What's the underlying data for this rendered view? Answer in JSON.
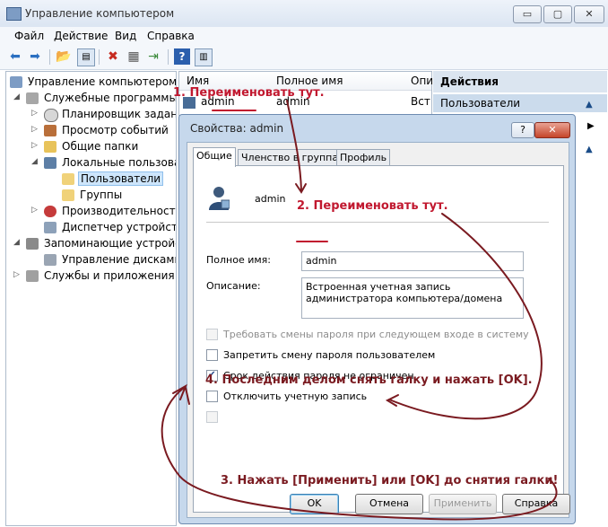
{
  "window": {
    "title": "Управление компьютером",
    "min": "▭",
    "max": "▢",
    "close": "✕"
  },
  "menu": [
    "Файл",
    "Действие",
    "Вид",
    "Справка"
  ],
  "tree": [
    {
      "label": "Управление компьютером (л",
      "depth": 0
    },
    {
      "label": "Служебные программы",
      "depth": 1
    },
    {
      "label": "Планировщик заданий",
      "depth": 2
    },
    {
      "label": "Просмотр событий",
      "depth": 2
    },
    {
      "label": "Общие папки",
      "depth": 2
    },
    {
      "label": "Локальные пользовате",
      "depth": 2
    },
    {
      "label": "Пользователи",
      "depth": 3
    },
    {
      "label": "Группы",
      "depth": 3
    },
    {
      "label": "Производительность",
      "depth": 2
    },
    {
      "label": "Диспетчер устройств",
      "depth": 2
    },
    {
      "label": "Запоминающие устройст",
      "depth": 1
    },
    {
      "label": "Управление дисками",
      "depth": 2
    },
    {
      "label": "Службы и приложения",
      "depth": 1
    }
  ],
  "list": {
    "col_name": "Имя",
    "col_fullname": "Полное имя",
    "col_desc": "Опи",
    "row_name": "admin",
    "row_fullname": "admin",
    "row_desc": "Вст"
  },
  "actions": {
    "header": "Действия",
    "section": "Пользователи"
  },
  "dialog": {
    "title": "Свойства: admin",
    "help": "?",
    "close": "✕",
    "tabs": [
      "Общие",
      "Членство в группах",
      "Профиль"
    ],
    "username": "admin",
    "fullname_label": "Полное имя:",
    "fullname_value": "admin",
    "desc_label": "Описание:",
    "desc_value": "Встроенная учетная запись администратора компьютера/домена",
    "checkboxes": [
      {
        "label": "Требовать смены пароля при следующем входе в систему",
        "checked": false,
        "disabled": true
      },
      {
        "label": "Запретить смену пароля пользователем",
        "checked": false,
        "disabled": false
      },
      {
        "label": "Срок действия пароля не ограничен",
        "checked": true,
        "disabled": false
      },
      {
        "label": "Отключить учетную запись",
        "checked": false,
        "disabled": false
      }
    ],
    "ok": "OK",
    "cancel": "Отмена",
    "apply": "Применить",
    "help_btn": "Справка"
  },
  "annotations": {
    "a1": "1. Переименовать тут.",
    "a2": "2. Переименовать тут.",
    "a3": "3. Нажать [Применить] или [OK] до снятия галки!",
    "a4": "4. Последним делом снять галку и нажать [OK]."
  },
  "colors": {
    "annotation_red": "#c1182f",
    "annotation_dark": "#7a1a20",
    "arrow": "#7a1a20"
  }
}
